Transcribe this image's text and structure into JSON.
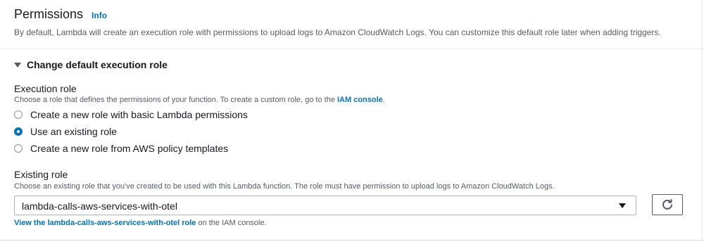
{
  "permissions": {
    "title": "Permissions",
    "info_label": "Info",
    "description": "By default, Lambda will create an execution role with permissions to upload logs to Amazon CloudWatch Logs. You can customize this default role later when adding triggers."
  },
  "expander": {
    "label": "Change default execution role"
  },
  "execution_role": {
    "label": "Execution role",
    "description_prefix": "Choose a role that defines the permissions of your function. To create a custom role, go to the ",
    "iam_link": "IAM console",
    "description_suffix": ".",
    "options": [
      {
        "label": "Create a new role with basic Lambda permissions",
        "checked": false
      },
      {
        "label": "Use an existing role",
        "checked": true
      },
      {
        "label": "Create a new role from AWS policy templates",
        "checked": false
      }
    ]
  },
  "existing_role": {
    "label": "Existing role",
    "description": "Choose an existing role that you've created to be used with this Lambda function. The role must have permission to upload logs to Amazon CloudWatch Logs.",
    "selected_value": "lambda-calls-aws-services-with-otel",
    "view_link": "View the lambda-calls-aws-services-with-otel role",
    "view_suffix": " on the IAM console."
  },
  "icons": {
    "refresh": "refresh-icon",
    "expander": "caret-down-icon",
    "select": "chevron-down-icon"
  },
  "colors": {
    "link": "#0073bb",
    "text": "#16191f",
    "secondary_text": "#545b64"
  }
}
